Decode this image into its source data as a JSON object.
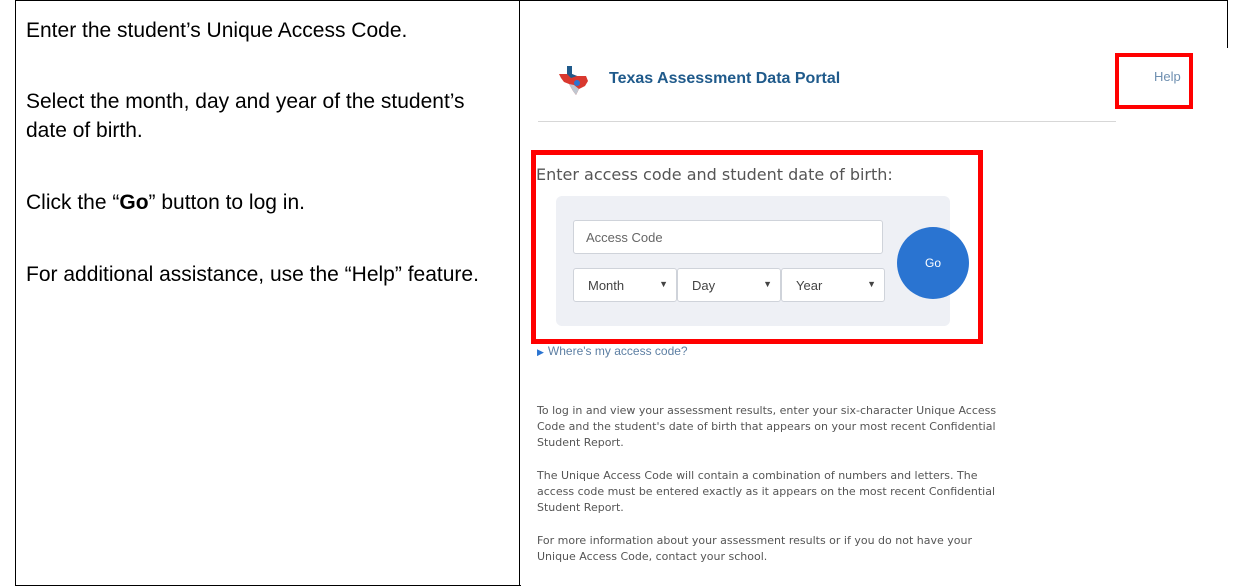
{
  "instructions": {
    "line1": "Enter the student’s Unique Access Code.",
    "line2": "Select the month, day and year of the student’s date of birth.",
    "line3_before": "Click the “",
    "line3_bold": "Go",
    "line3_after": "” button to log in.",
    "line4": "For additional assistance, use the “Help” feature."
  },
  "portal": {
    "title": "Texas Assessment Data Portal",
    "help_label": "Help",
    "login_heading": "Enter access code and student date of birth:",
    "access_code_placeholder": "Access Code",
    "month_label": "Month",
    "day_label": "Day",
    "year_label": "Year",
    "go_label": "Go",
    "where_link": "Where's my access code?",
    "info1": "To log in and view your assessment results, enter your six-character Unique Access Code and the student's date of birth that appears on your most recent Confidential Student Report.",
    "info2": "The Unique Access Code will contain a combination of numbers and letters. The access code must be entered exactly as it appears on the most recent Confidential Student Report.",
    "info3": "For more information about your assessment results or if you do not have your Unique Access Code, contact your school."
  },
  "colors": {
    "highlight": "#ff0000",
    "brand_blue": "#1f5a8b",
    "go_button": "#2a74d1"
  }
}
